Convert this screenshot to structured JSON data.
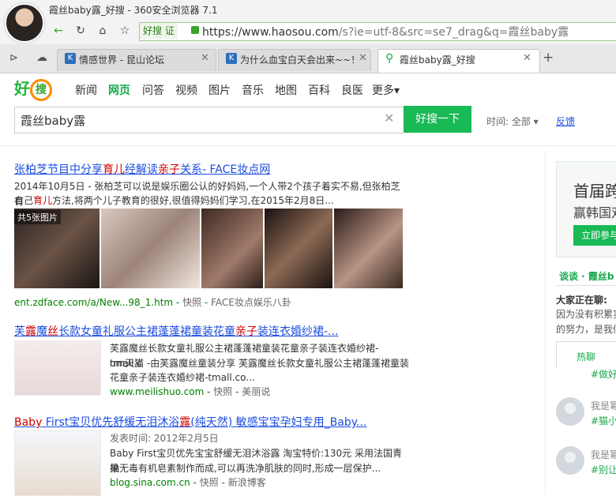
{
  "window": {
    "title": "霞丝baby露_好搜 - 360安全浏览器 7.1"
  },
  "addressbar": {
    "badge": "好搜 证",
    "url_domain": "https://www.haosou.com",
    "url_rest": "/s?ie=utf-8&src=se7_drag&q=霞丝baby露"
  },
  "tabs": [
    {
      "title": "情感世界 - 昆山论坛"
    },
    {
      "title": "为什么血宝白天会出来~~！解"
    },
    {
      "title": "霞丝baby露_好搜"
    }
  ],
  "logo": {
    "text1": "好",
    "text2": "搜"
  },
  "verticals": [
    "新闻",
    "网页",
    "问答",
    "视频",
    "图片",
    "音乐",
    "地图",
    "百科",
    "良医",
    "更多▾"
  ],
  "search": {
    "query": "霞丝baby露",
    "button": "好搜一下",
    "time_filter": "时间: 全部 ▾",
    "feedback": "反馈"
  },
  "results": [
    {
      "title": "张柏芝节目中分享育儿经解读亲子关系- FACE妆点网",
      "snippet1": "2014年10月5日 - 张柏芝可以说是娱乐圈公认的好妈妈,一个人带2个孩子着实不易,但张柏芝有",
      "snippet2": "自己育儿方法,将两个儿子教育的很好,很值得妈妈们学习,在2015年2月8日...",
      "img_count": "共5张图片",
      "url": "ent.zdface.com/a/New...98_1.htm",
      "snapshot": "快照",
      "source": "FACE妆点娱乐八卦"
    },
    {
      "title": "芙露魔丝长款女童礼服公主裙蓬蓬裙童装花童亲子装连衣婚纱裙-...",
      "snippet1": "芙露魔丝长款女童礼服公主裙蓬蓬裙童装花童亲子装连衣婚纱裙-tmall.c",
      "snippet2": "om天猫 -由芙露魔丝童装分享 芙露魔丝长款女童礼服公主裙蓬蓬裙童装",
      "snippet3": "花童亲子装连衣婚纱裙-tmall.co...",
      "url": "www.meilishuo.com",
      "snapshot": "快照",
      "source": "美丽说"
    },
    {
      "title": "Baby First宝贝优先舒缓无泪沐浴露(纯天然) 敏感宝宝孕妇专用_Baby...",
      "snippet1": "发表时间: 2012年2月5日",
      "snippet2": "Baby First宝贝优先宝宝舒缓无泪沐浴露 淘宝特价:130元 采用法国青柚",
      "snippet3": "果无毒有机皂素制作而成,可以再洗净肌肤的同时,形成一层保护...",
      "url": "blog.sina.com.cn",
      "snapshot": "快照",
      "source": "新浪博客"
    }
  ],
  "sidebar": {
    "ad_title": "首届跨",
    "ad_sub": "赢韩国双",
    "ad_button": "立即参与",
    "talk_label": "谈谈 · 霞丝b",
    "talking_head": "大家正在聊:",
    "talk_line1": "因为没有积累实",
    "talk_line2": "的努力，是我们",
    "hot_tab": "热聊",
    "items": [
      {
        "user": "",
        "tag": "#做好"
      },
      {
        "user": "我是幂",
        "tag": "#猫小宝"
      },
      {
        "user": "我是幂",
        "tag": "#别让"
      }
    ]
  }
}
